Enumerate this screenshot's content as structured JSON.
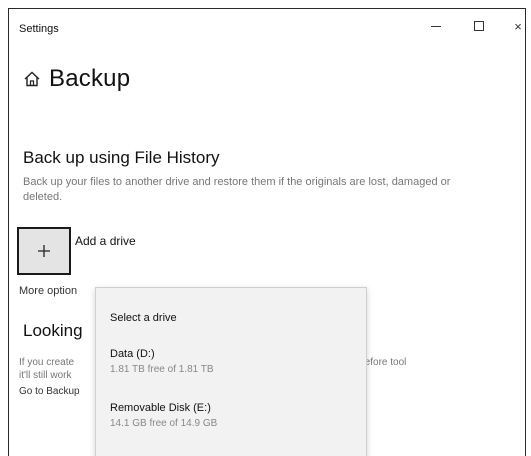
{
  "window": {
    "title": "Settings",
    "controls": {
      "minimize_icon": "minimize-icon",
      "maximize_icon": "maximize-icon",
      "close_glyph": "×"
    }
  },
  "page": {
    "icon": "home-icon",
    "title": "Backup"
  },
  "file_history": {
    "heading": "Back up using File History",
    "description": "Back up your files to another drive and restore them if the originals are lost, damaged or deleted.",
    "add_drive_label": "Add a drive",
    "add_icon": "plus-icon"
  },
  "more_options": {
    "label": "More option"
  },
  "looking": {
    "heading": "Looking",
    "line1": "If you create",
    "line2": "it'll still work",
    "link": "Go to Backup",
    "right_fragment": "Before tool"
  },
  "drive_dropdown": {
    "header": "Select a drive",
    "items": [
      {
        "name": "Data (D:)",
        "detail": "1.81 TB free of 1.81 TB"
      },
      {
        "name": "Removable Disk (E:)",
        "detail": "14.1 GB free of 14.9 GB"
      }
    ]
  },
  "colors": {
    "accent_text": "#111111",
    "muted_text": "#777777",
    "dropdown_bg": "#f2f2f2"
  }
}
